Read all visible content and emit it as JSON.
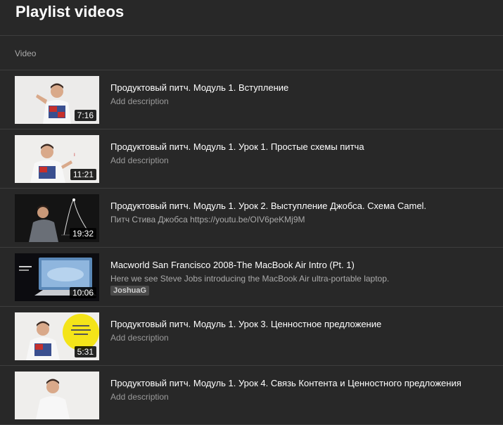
{
  "page": {
    "title": "Playlist videos"
  },
  "table": {
    "column_video": "Video"
  },
  "videos": [
    {
      "title": "Продуктовый питч. Модуль 1. Вступление",
      "description": "Add description",
      "duration": "7:16",
      "thumb_style": "light-presenter"
    },
    {
      "title": "Продуктовый питч. Модуль 1. Урок 1. Простые схемы питча",
      "description": "Add description",
      "duration": "11:21",
      "thumb_style": "light-presenter-sign"
    },
    {
      "title": "Продуктовый питч. Модуль 1. Урок 2. Выступление Джобса. Схема Camel.",
      "description": "Питч Стива Джобса https://youtu.be/OIV6peKMj9M",
      "duration": "19:32",
      "thumb_style": "dark-presenter"
    },
    {
      "title": "Macworld San Francisco 2008-The MacBook Air Intro (Pt. 1)",
      "description": "Here we see Steve Jobs introducing the MacBook Air ultra-portable laptop.",
      "duration": "10:06",
      "tag": "JoshuaG",
      "thumb_style": "keynote-laptop"
    },
    {
      "title": "Продуктовый питч. Модуль 1. Урок 3. Ценностное предложение",
      "description": "Add description",
      "duration": "5:31",
      "thumb_style": "light-presenter-yellow"
    },
    {
      "title": "Продуктовый питч. Модуль 1. Урок 4. Связь Контента и Ценностного предложения",
      "description": "Add description",
      "duration": "",
      "thumb_style": "light-presenter"
    }
  ]
}
